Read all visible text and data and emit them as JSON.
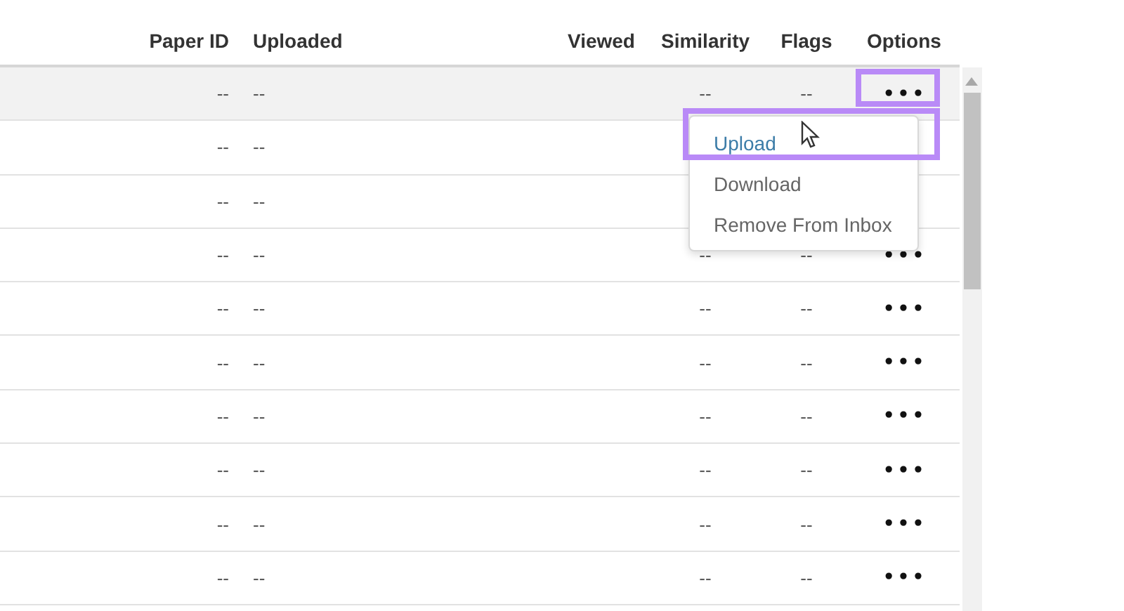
{
  "table": {
    "columns": [
      {
        "label": "Paper ID"
      },
      {
        "label": "Uploaded"
      },
      {
        "label": "Viewed"
      },
      {
        "label": "Similarity"
      },
      {
        "label": "Flags"
      },
      {
        "label": "Options"
      }
    ],
    "rows": [
      {
        "selected": true,
        "paper_id": "--",
        "uploaded": "--",
        "similarity": "--",
        "flags": "--",
        "options": "•••"
      },
      {
        "selected": false,
        "paper_id": "--",
        "uploaded": "--"
      },
      {
        "selected": false,
        "paper_id": "--",
        "uploaded": "--"
      },
      {
        "selected": false,
        "paper_id": "--",
        "uploaded": "--",
        "similarity": "--",
        "flags": "--",
        "options": "•••"
      },
      {
        "selected": false,
        "paper_id": "--",
        "uploaded": "--",
        "similarity": "--",
        "flags": "--",
        "options": "•••"
      },
      {
        "selected": false,
        "paper_id": "--",
        "uploaded": "--",
        "similarity": "--",
        "flags": "--",
        "options": "•••"
      },
      {
        "selected": false,
        "paper_id": "--",
        "uploaded": "--",
        "similarity": "--",
        "flags": "--",
        "options": "•••"
      },
      {
        "selected": false,
        "paper_id": "--",
        "uploaded": "--",
        "similarity": "--",
        "flags": "--",
        "options": "•••"
      },
      {
        "selected": false,
        "paper_id": "--",
        "uploaded": "--",
        "similarity": "--",
        "flags": "--",
        "options": "•••"
      },
      {
        "selected": false,
        "paper_id": "--",
        "uploaded": "--",
        "similarity": "--",
        "flags": "--",
        "options": "•••"
      }
    ]
  },
  "options_menu": {
    "items": [
      {
        "label": "Upload",
        "selected": true
      },
      {
        "label": "Download",
        "selected": false
      },
      {
        "label": "Remove From Inbox",
        "selected": false
      }
    ]
  }
}
